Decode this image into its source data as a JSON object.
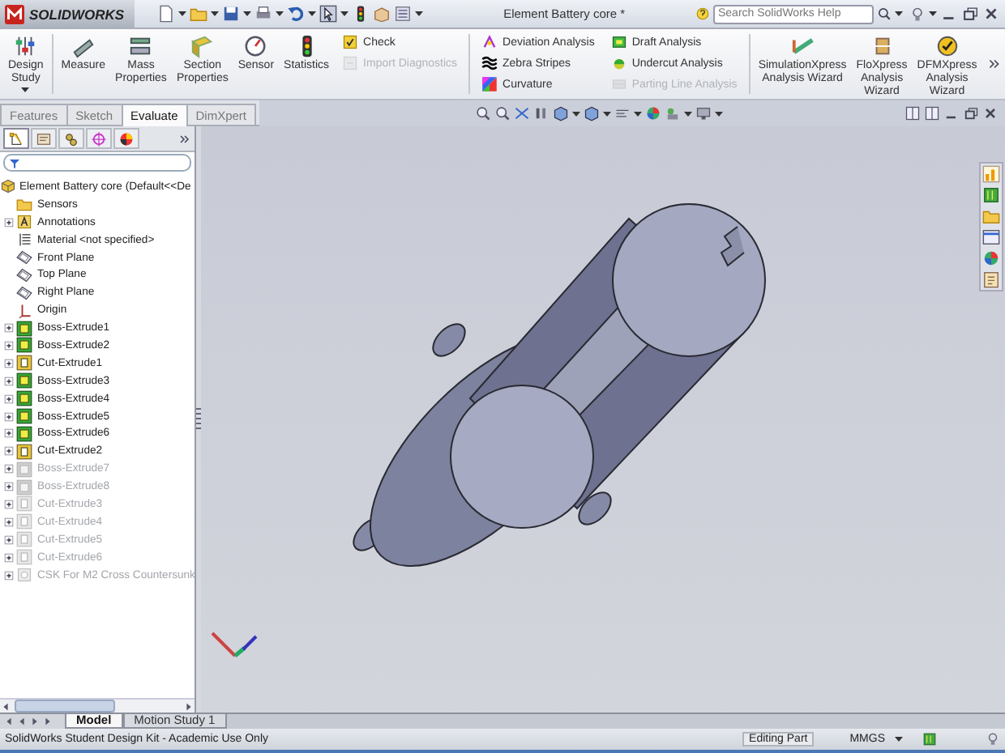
{
  "app": {
    "logo": "SOLIDWORKS",
    "title": "Element Battery core *",
    "search": {
      "placeholder": "Search SolidWorks Help"
    }
  },
  "ribbon": [
    {
      "kind": "large_menu",
      "label": "Design Study"
    },
    {
      "kind": "separator"
    },
    {
      "kind": "large",
      "label": "Measure"
    },
    {
      "kind": "large",
      "label": "Mass Properties"
    },
    {
      "kind": "large",
      "label": "Section Properties"
    },
    {
      "kind": "large",
      "label": "Sensor"
    },
    {
      "kind": "large",
      "label": "Statistics"
    },
    {
      "kind": "stack",
      "items": [
        {
          "label": "Check",
          "disabled": false
        },
        {
          "label": "Import Diagnostics",
          "disabled": true
        }
      ]
    },
    {
      "kind": "separator"
    },
    {
      "kind": "stack",
      "items": [
        {
          "label": "Deviation Analysis",
          "disabled": false
        },
        {
          "label": "Zebra Stripes",
          "disabled": false
        },
        {
          "label": "Curvature",
          "disabled": false
        }
      ]
    },
    {
      "kind": "stack",
      "items": [
        {
          "label": "Draft Analysis",
          "disabled": false
        },
        {
          "label": "Undercut Analysis",
          "disabled": false
        },
        {
          "label": "Parting Line Analysis",
          "disabled": true
        }
      ]
    },
    {
      "kind": "separator"
    },
    {
      "kind": "large",
      "label": "SimulationXpress Analysis Wizard"
    },
    {
      "kind": "large",
      "label": "FloXpress Analysis Wizard"
    },
    {
      "kind": "large",
      "label": "DFMXpress Analysis Wizard"
    }
  ],
  "command_tabs": [
    {
      "label": "Features",
      "selected": false
    },
    {
      "label": "Sketch",
      "selected": false
    },
    {
      "label": "Evaluate",
      "selected": true
    },
    {
      "label": "DimXpert",
      "selected": false
    }
  ],
  "panel_tabs": [
    {
      "selected": true
    },
    {
      "selected": false
    },
    {
      "selected": false
    },
    {
      "selected": false
    },
    {
      "selected": false
    }
  ],
  "feature_tree": {
    "label": "Element Battery core (Default<<De",
    "children": [
      {
        "label": "Sensors",
        "kind": "folder",
        "expandable": false,
        "suppressed": false
      },
      {
        "label": "Annotations",
        "kind": "annotations",
        "expandable": true,
        "suppressed": false
      },
      {
        "label": "Material <not specified>",
        "kind": "material",
        "expandable": false,
        "suppressed": false
      },
      {
        "label": "Front Plane",
        "kind": "plane",
        "expandable": false,
        "suppressed": false
      },
      {
        "label": "Top Plane",
        "kind": "plane",
        "expandable": false,
        "suppressed": false
      },
      {
        "label": "Right Plane",
        "kind": "plane",
        "expandable": false,
        "suppressed": false
      },
      {
        "label": "Origin",
        "kind": "origin",
        "expandable": false,
        "suppressed": false
      },
      {
        "label": "Boss-Extrude1",
        "kind": "boss",
        "expandable": true,
        "suppressed": false
      },
      {
        "label": "Boss-Extrude2",
        "kind": "boss",
        "expandable": true,
        "suppressed": false
      },
      {
        "label": "Cut-Extrude1",
        "kind": "cut",
        "expandable": true,
        "suppressed": false
      },
      {
        "label": "Boss-Extrude3",
        "kind": "boss",
        "expandable": true,
        "suppressed": false
      },
      {
        "label": "Boss-Extrude4",
        "kind": "boss",
        "expandable": true,
        "suppressed": false
      },
      {
        "label": "Boss-Extrude5",
        "kind": "boss",
        "expandable": true,
        "suppressed": false
      },
      {
        "label": "Boss-Extrude6",
        "kind": "boss",
        "expandable": true,
        "suppressed": false
      },
      {
        "label": "Cut-Extrude2",
        "kind": "cut",
        "expandable": true,
        "suppressed": false
      },
      {
        "label": "Boss-Extrude7",
        "kind": "boss",
        "expandable": true,
        "suppressed": true
      },
      {
        "label": "Boss-Extrude8",
        "kind": "boss",
        "expandable": true,
        "suppressed": true
      },
      {
        "label": "Cut-Extrude3",
        "kind": "cut",
        "expandable": true,
        "suppressed": true
      },
      {
        "label": "Cut-Extrude4",
        "kind": "cut",
        "expandable": true,
        "suppressed": true
      },
      {
        "label": "Cut-Extrude5",
        "kind": "cut",
        "expandable": true,
        "suppressed": true
      },
      {
        "label": "Cut-Extrude6",
        "kind": "cut",
        "expandable": true,
        "suppressed": true
      },
      {
        "label": "CSK For M2 Cross Countersunk",
        "kind": "hole",
        "expandable": true,
        "suppressed": true
      }
    ]
  },
  "bottom_tabs": [
    {
      "label": "Model",
      "selected": true
    },
    {
      "label": "Motion Study 1",
      "selected": false
    }
  ],
  "status_bar": {
    "message": "SolidWorks Student Design Kit - Academic Use Only",
    "mode": "Editing Part",
    "units": "MMGS"
  }
}
